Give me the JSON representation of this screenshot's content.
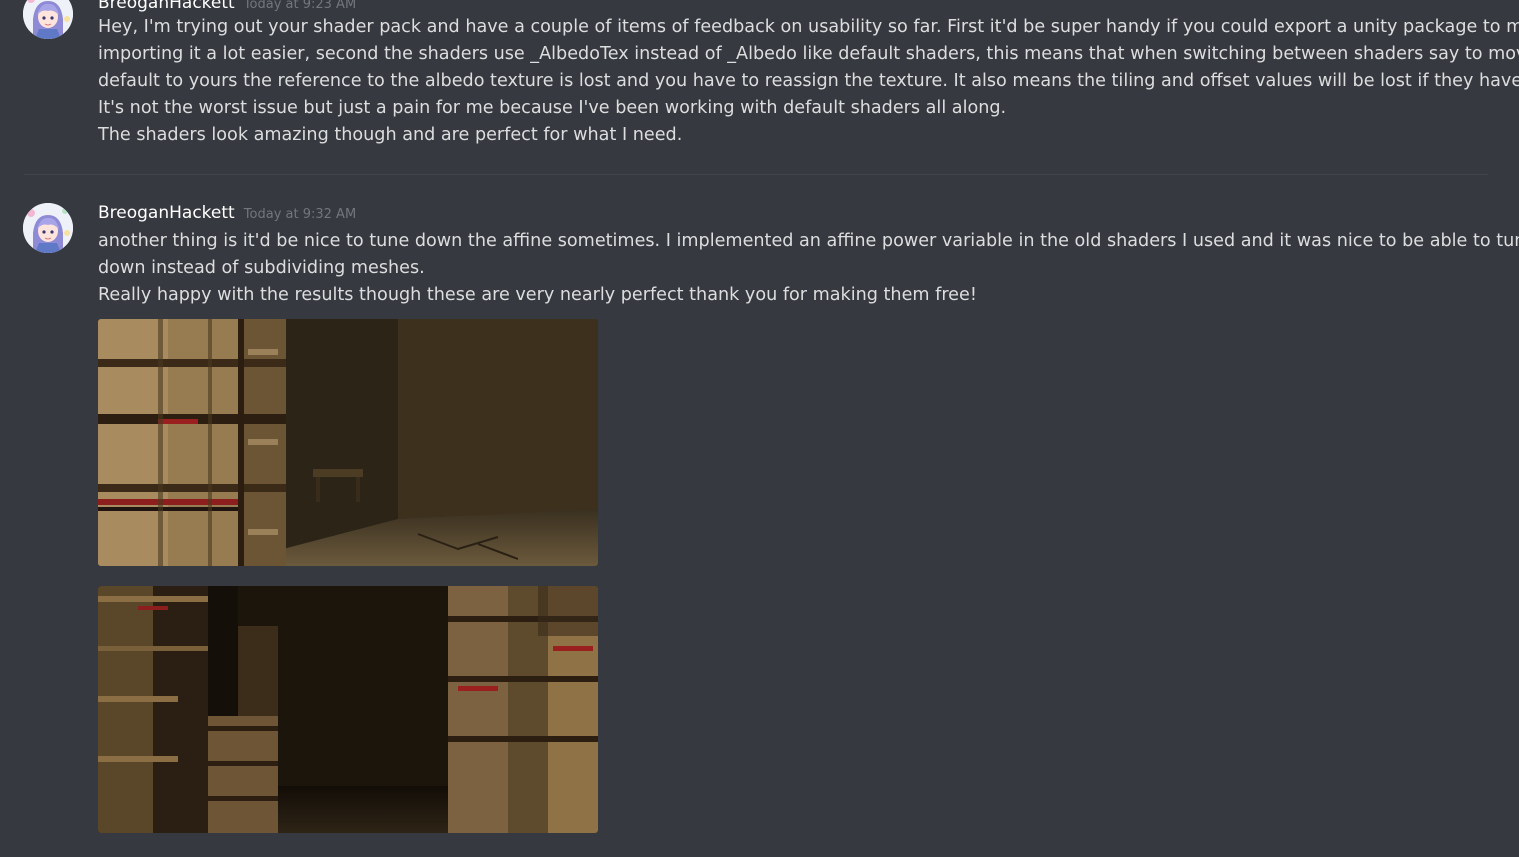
{
  "messages": [
    {
      "username": "BreoganHackett",
      "timestamp": "Today at 9:23 AM",
      "lines": [
        "Hey, I'm trying out your shader pack and have a couple of items of feedback on usability so far. First it'd be super handy if you could export a unity package to make",
        "importing it a lot easier, second the shaders use  _AlbedoTex instead of _Albedo like default shaders, this means that when switching between shaders say to move from",
        "default to yours the reference to the albedo texture is lost and you have to reassign the texture. It also means the tiling and offset values will be lost if they have been set.",
        "It's not the worst issue but just a pain for me because I've been working with default shaders all along.",
        "The shaders look amazing though and are perfect for what I need."
      ]
    },
    {
      "username": "BreoganHackett",
      "timestamp": "Today at 9:32 AM",
      "lines": [
        "another thing is it'd be nice to tune down the affine sometimes. I implemented an affine power variable in the old shaders I used and it was nice to be able to tune it",
        "down instead of subdividing meshes.",
        "Really happy with the results though these are very nearly perfect thank you for making them free!"
      ]
    }
  ],
  "colors": {
    "background": "#36393f",
    "username": "#ffffff",
    "timestamp": "#72767d",
    "text": "#dcddde",
    "divider": "#40444b"
  }
}
